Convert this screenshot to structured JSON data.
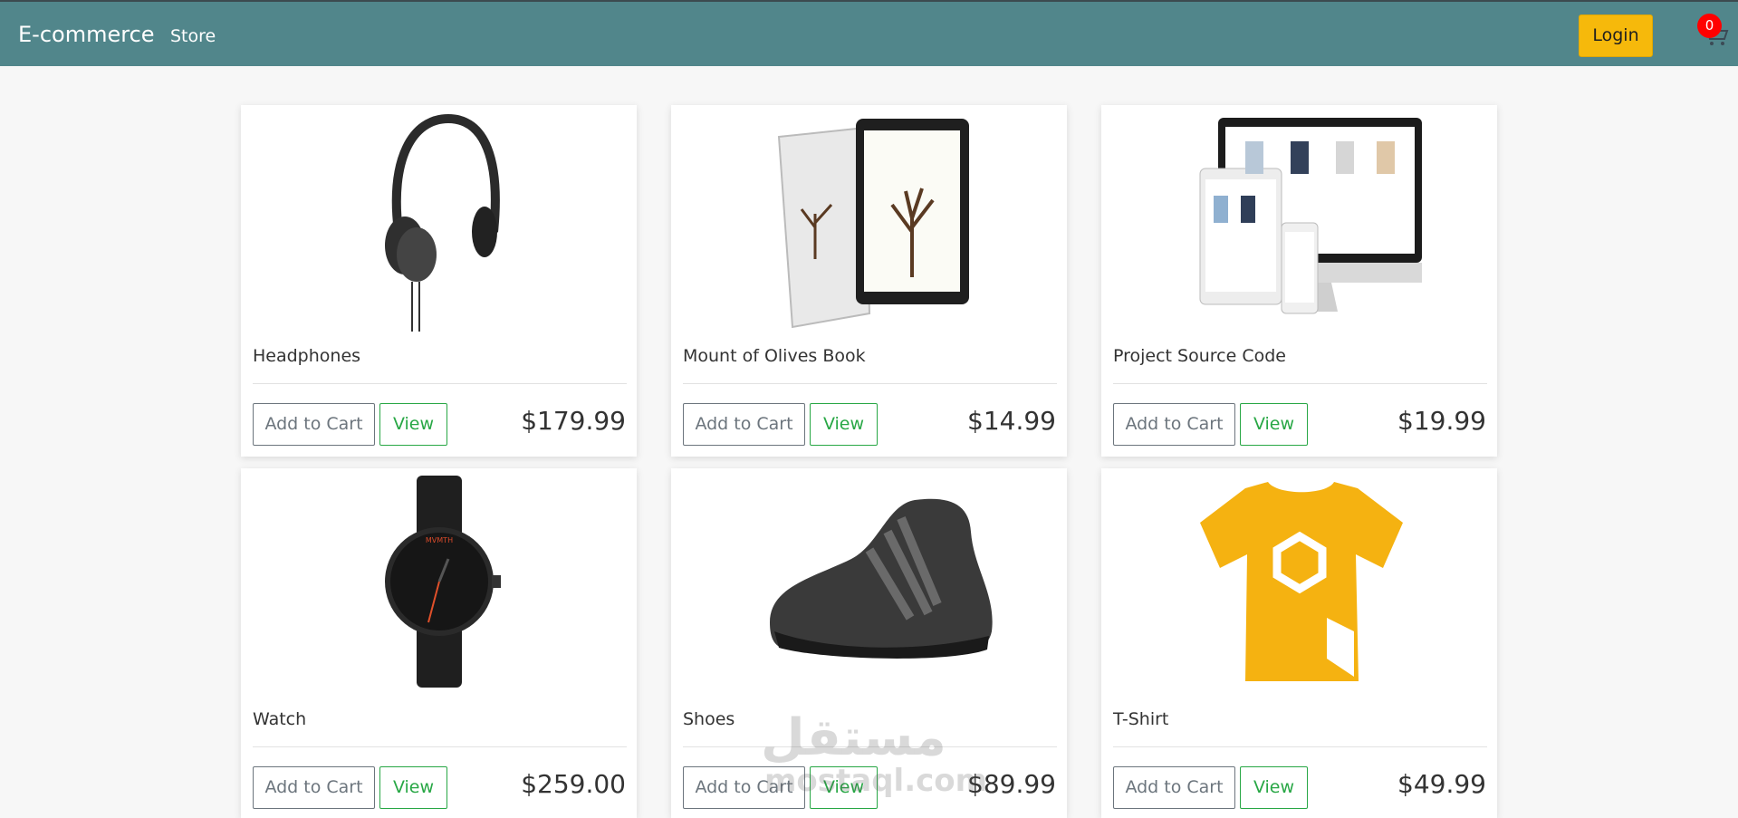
{
  "navbar": {
    "brand": "E-commerce",
    "store_link": "Store",
    "login_label": "Login",
    "cart_count": "0",
    "cart_icon": "cart-icon"
  },
  "products": [
    {
      "title": "Headphones",
      "price": "$179.99",
      "add_label": "Add to Cart",
      "view_label": "View",
      "image": "headphones"
    },
    {
      "title": "Mount of Olives Book",
      "price": "$14.99",
      "add_label": "Add to Cart",
      "view_label": "View",
      "image": "book"
    },
    {
      "title": "Project Source Code",
      "price": "$19.99",
      "add_label": "Add to Cart",
      "view_label": "View",
      "image": "devices"
    },
    {
      "title": "Watch",
      "price": "$259.00",
      "add_label": "Add to Cart",
      "view_label": "View",
      "image": "watch"
    },
    {
      "title": "Shoes",
      "price": "$89.99",
      "add_label": "Add to Cart",
      "view_label": "View",
      "image": "shoe"
    },
    {
      "title": "T-Shirt",
      "price": "$49.99",
      "add_label": "Add to Cart",
      "view_label": "View",
      "image": "tshirt"
    }
  ],
  "watermark": {
    "arabic": "مستقل",
    "latin": "mostaql.com"
  },
  "colors": {
    "navbar": "#51868b",
    "login": "#f6b90b",
    "badge": "#ff0000",
    "view_button": "#28a745"
  }
}
